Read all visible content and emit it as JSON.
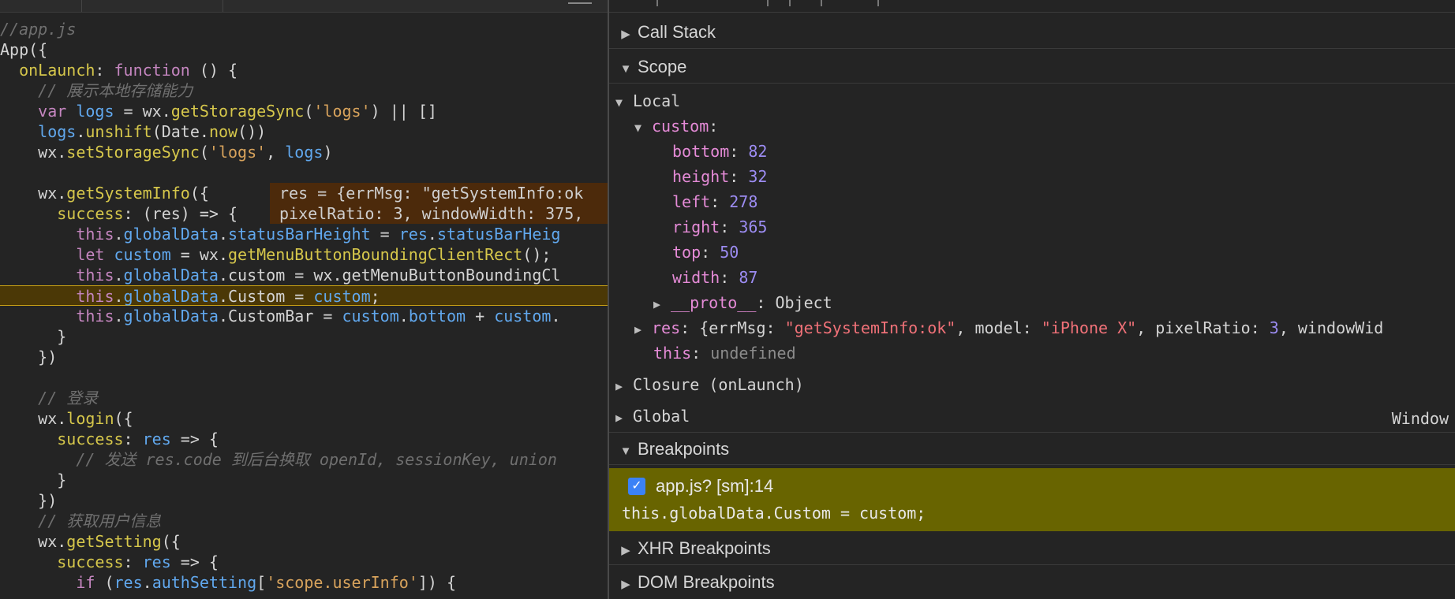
{
  "editor": {
    "tabs": [],
    "lines": [
      {
        "text": "//app.js"
      },
      {
        "text": "App({"
      },
      {
        "text": "  onLaunch: function () {"
      },
      {
        "text": "    // 展示本地存储能力"
      },
      {
        "text": "    var logs = wx.getStorageSync('logs') || []"
      },
      {
        "text": "    logs.unshift(Date.now())"
      },
      {
        "text": "    wx.setStorageSync('logs', logs)"
      },
      {
        "text": ""
      },
      {
        "text": "    wx.getSystemInfo({"
      },
      {
        "text": "      success: (res) => {"
      },
      {
        "text": "        this.globalData.statusBarHeight = res.statusBarHeig"
      },
      {
        "text": "        let custom = wx.getMenuButtonBoundingClientRect();"
      },
      {
        "text": "        this.globalData.custom = wx.getMenuButtonBoundingCl"
      },
      {
        "text": "        this.globalData.Custom = custom;"
      },
      {
        "text": "        this.globalData.CustomBar = custom.bottom + custom."
      },
      {
        "text": "      }"
      },
      {
        "text": "    })"
      },
      {
        "text": ""
      },
      {
        "text": "    // 登录"
      },
      {
        "text": "    wx.login({"
      },
      {
        "text": "      success: res => {"
      },
      {
        "text": "        // 发送 res.code 到后台换取 openId, sessionKey, union"
      },
      {
        "text": "      }"
      },
      {
        "text": "    })"
      },
      {
        "text": "    // 获取用户信息"
      },
      {
        "text": "    wx.getSetting({"
      },
      {
        "text": "      success: res => {"
      },
      {
        "text": "        if (res.authSetting['scope.userInfo']) {"
      }
    ],
    "current_line": 13,
    "inline_values": [
      "res = {errMsg: \"getSystemInfo:ok",
      "pixelRatio: 3, windowWidth: 375,"
    ]
  },
  "devtools": {
    "sections": {
      "call_stack": "Call Stack",
      "scope": "Scope",
      "breakpoints": "Breakpoints",
      "xhr_breakpoints": "XHR Breakpoints",
      "dom_breakpoints": "DOM Breakpoints"
    },
    "scope": {
      "local_label": "Local",
      "custom_key": "custom",
      "custom_props": [
        {
          "key": "bottom",
          "value": "82"
        },
        {
          "key": "height",
          "value": "32"
        },
        {
          "key": "left",
          "value": "278"
        },
        {
          "key": "right",
          "value": "365"
        },
        {
          "key": "top",
          "value": "50"
        },
        {
          "key": "width",
          "value": "87"
        }
      ],
      "proto_key": "__proto__",
      "proto_value": "Object",
      "res_key": "res",
      "res_errmsg_key": "errMsg",
      "res_errmsg": "\"getSystemInfo:ok\"",
      "res_model_key": "model",
      "res_model": "\"iPhone X\"",
      "res_pixelratio_key": "pixelRatio",
      "res_pixelratio": "3",
      "res_tail": "windowWid",
      "this_key": "this",
      "this_value": "undefined",
      "closure_label": "Closure (onLaunch)",
      "global_label": "Global",
      "global_value": "Window"
    },
    "breakpoint": {
      "checked": true,
      "label": "app.js? [sm]:14",
      "code": "this.globalData.Custom = custom;"
    },
    "colors": {
      "breakpoint_bg": "#686400",
      "current_line_bg": "#4b3806",
      "checkbox": "#3b82f6"
    }
  }
}
